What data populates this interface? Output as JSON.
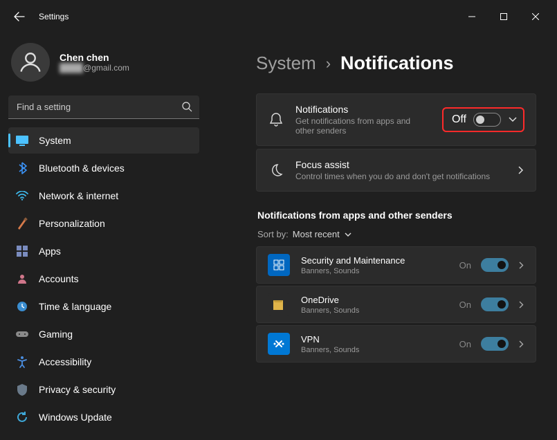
{
  "window": {
    "title": "Settings"
  },
  "profile": {
    "name": "Chen chen",
    "email_redacted": "████",
    "email_suffix": "@gmail.com"
  },
  "search": {
    "placeholder": "Find a setting"
  },
  "nav": [
    {
      "key": "system",
      "label": "System",
      "selected": true
    },
    {
      "key": "bluetooth",
      "label": "Bluetooth & devices"
    },
    {
      "key": "network",
      "label": "Network & internet"
    },
    {
      "key": "personalization",
      "label": "Personalization"
    },
    {
      "key": "apps",
      "label": "Apps"
    },
    {
      "key": "accounts",
      "label": "Accounts"
    },
    {
      "key": "time",
      "label": "Time & language"
    },
    {
      "key": "gaming",
      "label": "Gaming"
    },
    {
      "key": "accessibility",
      "label": "Accessibility"
    },
    {
      "key": "privacy",
      "label": "Privacy & security"
    },
    {
      "key": "update",
      "label": "Windows Update"
    }
  ],
  "breadcrumb": {
    "parent": "System",
    "current": "Notifications"
  },
  "main": {
    "notifications_card": {
      "title": "Notifications",
      "subtitle": "Get notifications from apps and other senders",
      "state_text": "Off",
      "toggled": false
    },
    "focus_card": {
      "title": "Focus assist",
      "subtitle": "Control times when you do and don't get notifications"
    }
  },
  "section": {
    "heading": "Notifications from apps and other senders",
    "sort_label": "Sort by:",
    "sort_value": "Most recent"
  },
  "apps": [
    {
      "name": "Security and Maintenance",
      "sub": "Banners, Sounds",
      "state": "On",
      "color": "#0067c0"
    },
    {
      "name": "OneDrive",
      "sub": "Banners, Sounds",
      "state": "On",
      "color": "#b8933b"
    },
    {
      "name": "VPN",
      "sub": "Banners, Sounds",
      "state": "On",
      "color": "#0078d4"
    }
  ]
}
